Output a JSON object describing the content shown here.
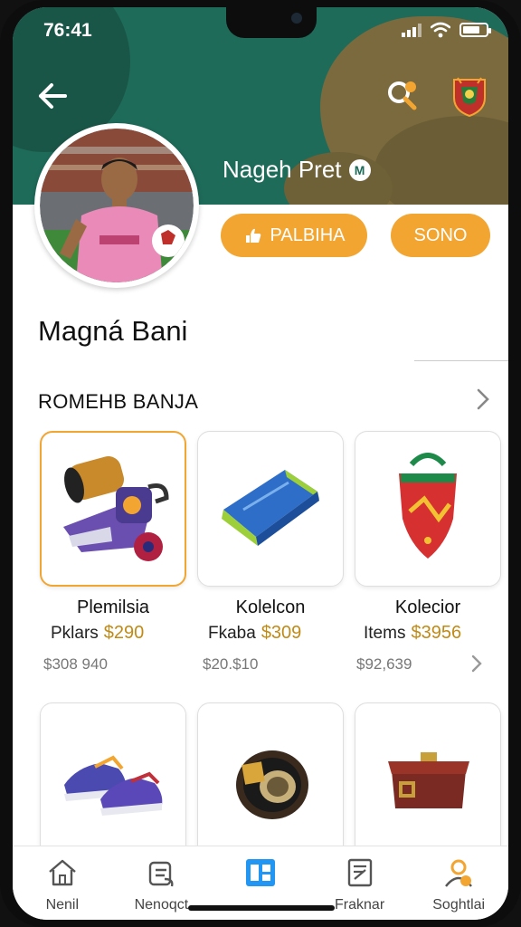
{
  "status_bar": {
    "time": "76:41"
  },
  "header": {
    "profile_name": "Nageh Pret",
    "verified_badge": "M",
    "buttons": [
      {
        "label": "PALBIHA",
        "icon": "hand-icon"
      },
      {
        "label": "SONO"
      }
    ]
  },
  "section": {
    "title": "Magná Bani",
    "subtitle": "ROMEHB BANJA"
  },
  "items": [
    {
      "name": "Plemilsia",
      "label": "Pklars",
      "price": "$290",
      "old_price": "$308 940",
      "icon": "gear-kit-icon",
      "selected": true
    },
    {
      "name": "Kolelcon",
      "label": "Fkaba",
      "price": "$309",
      "old_price": "$20.$10",
      "icon": "mat-icon",
      "selected": false
    },
    {
      "name": "Kolecior",
      "label": "Items",
      "price": "$3956",
      "old_price": "$92,639",
      "icon": "shield-icon",
      "selected": false
    },
    {
      "name": "",
      "label": "",
      "price": "",
      "old_price": "",
      "icon": "sneakers-icon",
      "selected": false
    },
    {
      "name": "",
      "label": "",
      "price": "",
      "old_price": "",
      "icon": "tape-roll-icon",
      "selected": false
    },
    {
      "name": "",
      "label": "",
      "price": "",
      "old_price": "",
      "icon": "chest-icon",
      "selected": false
    }
  ],
  "bottom_nav": [
    {
      "label": "Nenil",
      "icon": "home-icon"
    },
    {
      "label": "Nenoqct",
      "icon": "bag-icon"
    },
    {
      "label": "",
      "icon": "grid-icon",
      "active": true
    },
    {
      "label": "Fraknar",
      "icon": "note-icon"
    },
    {
      "label": "Soghtlai",
      "icon": "user-icon"
    }
  ],
  "colors": {
    "accent": "#f2a531",
    "banner": "#1e6b5a",
    "active_nav": "#2196f3"
  }
}
